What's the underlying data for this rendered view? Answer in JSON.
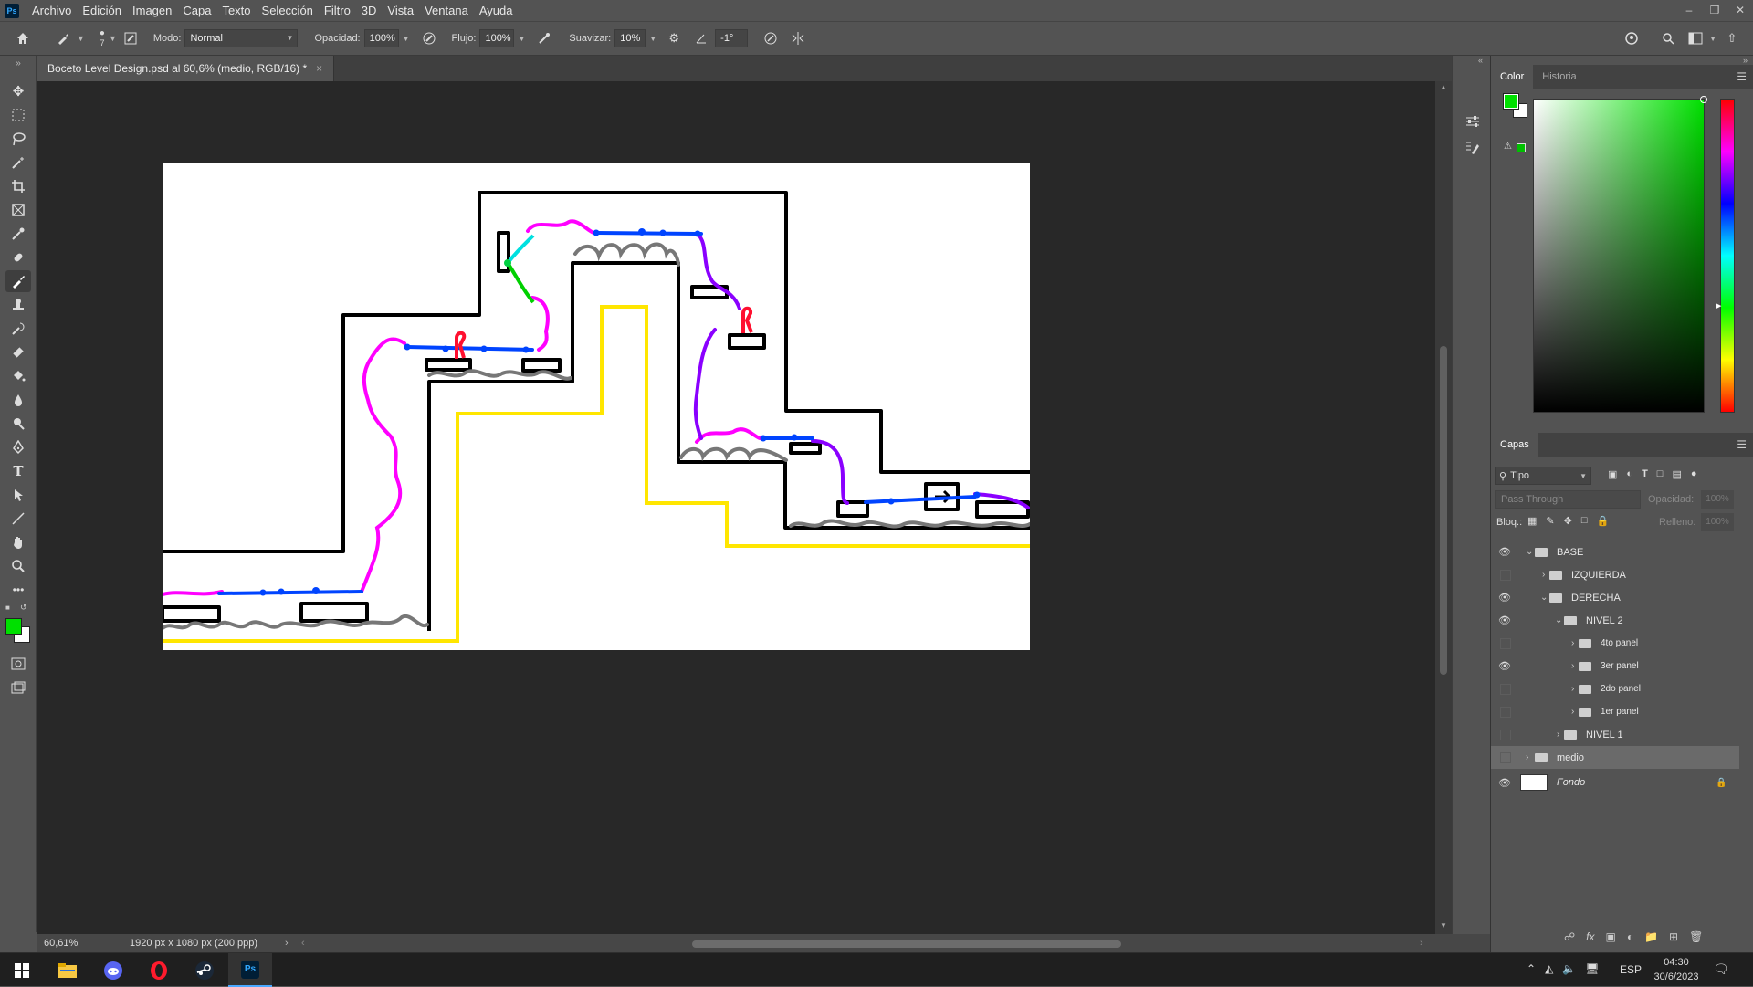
{
  "app": {
    "logo": "Ps",
    "menu": [
      "Archivo",
      "Edición",
      "Imagen",
      "Capa",
      "Texto",
      "Selección",
      "Filtro",
      "3D",
      "Vista",
      "Ventana",
      "Ayuda"
    ]
  },
  "options": {
    "brush_size": "7",
    "mode_label": "Modo:",
    "mode_value": "Normal",
    "opacity_label": "Opacidad:",
    "opacity_value": "100%",
    "flow_label": "Flujo:",
    "flow_value": "100%",
    "smooth_label": "Suavizar:",
    "smooth_value": "10%",
    "angle_value": "-1°"
  },
  "document": {
    "tab_title": "Boceto Level Design.psd al 60,6% (medio, RGB/16) *",
    "close": "×"
  },
  "status": {
    "zoom": "60,61%",
    "info": "1920 px x 1080 px (200 ppp)"
  },
  "color_panel": {
    "tabs": [
      "Color",
      "Historia"
    ],
    "foreground": "#00e000",
    "background": "#ffffff"
  },
  "layers_panel": {
    "title": "Capas",
    "filter_label": "Tipo",
    "blend_mode": "Pass Through",
    "opacity_label": "Opacidad:",
    "opacity_value": "100%",
    "lock_label": "Bloq.:",
    "fill_label": "Relleno:",
    "fill_value": "100%",
    "layers": [
      {
        "name": "BASE",
        "visible": true
      },
      {
        "name": "IZQUIERDA",
        "visible": false
      },
      {
        "name": "DERECHA",
        "visible": true
      },
      {
        "name": "NIVEL 2",
        "visible": true
      },
      {
        "name": "4to panel",
        "visible": false
      },
      {
        "name": "3er panel",
        "visible": true
      },
      {
        "name": "2do panel",
        "visible": false
      },
      {
        "name": "1er panel",
        "visible": false
      },
      {
        "name": "NIVEL 1",
        "visible": false
      },
      {
        "name": "medio",
        "visible": false
      },
      {
        "name": "Fondo",
        "visible": true
      }
    ]
  },
  "taskbar": {
    "lang": "ESP",
    "time": "04:30",
    "date": "30/6/2023"
  }
}
